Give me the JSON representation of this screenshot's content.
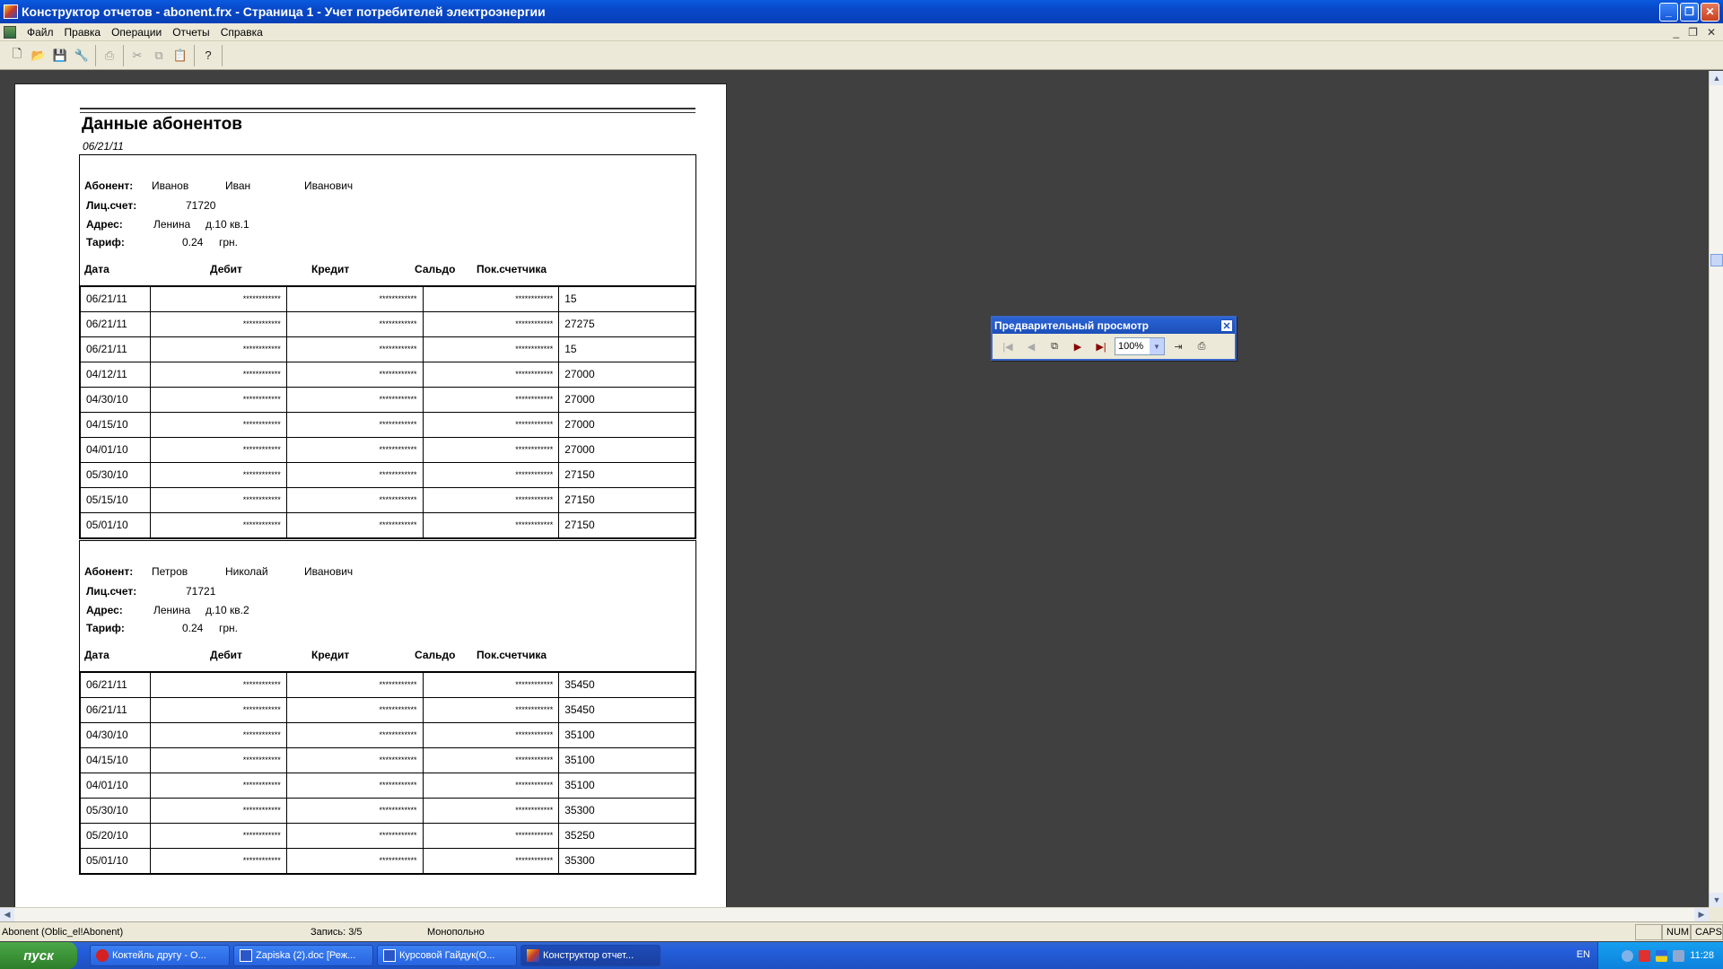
{
  "window": {
    "title": "Конструктор отчетов - abonent.frx - Страница 1 - Учет потребителей электроэнергии"
  },
  "menu": [
    "Файл",
    "Правка",
    "Операции",
    "Отчеты",
    "Справка"
  ],
  "report": {
    "title": "Данные абонентов",
    "date": "06/21/11",
    "labels": {
      "abonent": "Абонент:",
      "account": "Лиц.счет:",
      "address": "Адрес:",
      "tariff": "Тариф:"
    },
    "headers": {
      "date": "Дата",
      "debit": "Дебит",
      "credit": "Кредит",
      "saldo": "Сальдо",
      "meter": "Пок.счетчика"
    },
    "mask": "************",
    "subscribers": [
      {
        "surname": "Иванов",
        "name": "Иван",
        "patronymic": "Иванович",
        "account": "71720",
        "street": "Ленина",
        "house": "д.10 кв.1",
        "tariff": "0.24",
        "currency": "грн.",
        "rows": [
          {
            "date": "06/21/11",
            "meter": "15"
          },
          {
            "date": "06/21/11",
            "meter": "27275"
          },
          {
            "date": "06/21/11",
            "meter": "15"
          },
          {
            "date": "04/12/11",
            "meter": "27000"
          },
          {
            "date": "04/30/10",
            "meter": "27000"
          },
          {
            "date": "04/15/10",
            "meter": "27000"
          },
          {
            "date": "04/01/10",
            "meter": "27000"
          },
          {
            "date": "05/30/10",
            "meter": "27150"
          },
          {
            "date": "05/15/10",
            "meter": "27150"
          },
          {
            "date": "05/01/10",
            "meter": "27150"
          }
        ]
      },
      {
        "surname": "Петров",
        "name": "Николай",
        "patronymic": "Иванович",
        "account": "71721",
        "street": "Ленина",
        "house": "д.10 кв.2",
        "tariff": "0.24",
        "currency": "грн.",
        "rows": [
          {
            "date": "06/21/11",
            "meter": "35450"
          },
          {
            "date": "06/21/11",
            "meter": "35450"
          },
          {
            "date": "04/30/10",
            "meter": "35100"
          },
          {
            "date": "04/15/10",
            "meter": "35100"
          },
          {
            "date": "04/01/10",
            "meter": "35100"
          },
          {
            "date": "05/30/10",
            "meter": "35300"
          },
          {
            "date": "05/20/10",
            "meter": "35250"
          },
          {
            "date": "05/01/10",
            "meter": "35300"
          }
        ]
      }
    ]
  },
  "preview_toolbar": {
    "title": "Предварительный просмотр",
    "zoom": "100%"
  },
  "status": {
    "alias": "Abonent (Oblic_el!Abonent)",
    "record": "Запись: 3/5",
    "mode": "Монопольно",
    "num": "NUM",
    "caps": "CAPS"
  },
  "taskbar": {
    "start": "пуск",
    "tasks": [
      {
        "label": "Коктейль другу - О...",
        "active": false
      },
      {
        "label": "Zapiska (2).doc [Реж...",
        "active": false
      },
      {
        "label": "Курсовой Гайдук(О...",
        "active": false
      },
      {
        "label": "Конструктор отчет...",
        "active": true
      }
    ],
    "lang": "EN",
    "clock": "11:28"
  }
}
